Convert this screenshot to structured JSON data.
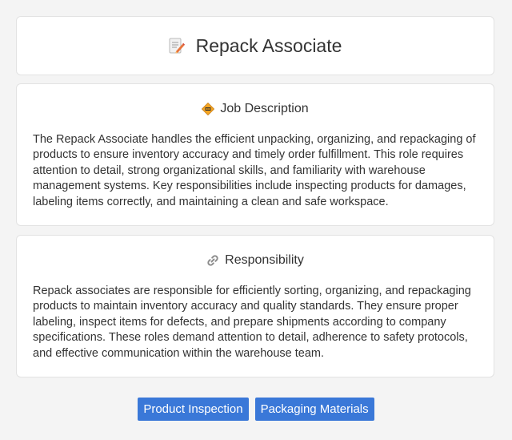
{
  "header": {
    "title": "Repack Associate",
    "icon": "memo-pencil-icon"
  },
  "job_description": {
    "heading": "Job Description",
    "icon": "construction-sign-icon",
    "body": "The Repack Associate handles the efficient unpacking, organizing, and repackaging of products to ensure inventory accuracy and timely order fulfillment. This role requires attention to detail, strong organizational skills, and familiarity with warehouse management systems. Key responsibilities include inspecting products for damages, labeling items correctly, and maintaining a clean and safe workspace."
  },
  "responsibility": {
    "heading": "Responsibility",
    "icon": "link-icon",
    "body": "Repack associates are responsible for efficiently sorting, organizing, and repackaging products to maintain inventory accuracy and quality standards. They ensure proper labeling, inspect items for defects, and prepare shipments according to company specifications. These roles demand attention to detail, adherence to safety protocols, and effective communication within the warehouse team."
  },
  "tags": [
    {
      "label": "Product Inspection"
    },
    {
      "label": "Packaging Materials"
    }
  ],
  "colors": {
    "tag_background": "#3a78d8",
    "page_background": "#f4f4f4"
  }
}
